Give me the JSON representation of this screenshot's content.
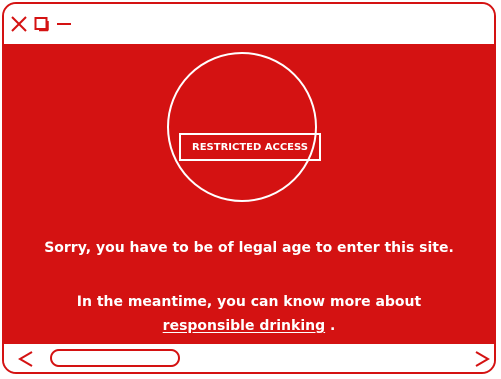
{
  "window": {
    "accent_color": "#d41212",
    "controls": [
      "close-icon",
      "maximize-icon",
      "minimize-icon"
    ]
  },
  "content": {
    "badge_text": "RESTRICTED ACCESS",
    "message_line1": "Sorry, you have to be of  legal age to enter this site.",
    "message_line2": "In the meantime, you can know more about",
    "link_text": "responsible drinking",
    "link_suffix": " ."
  },
  "footer": {
    "left_arrow_icon": "chevron-left-icon",
    "right_arrow_icon": "chevron-right-icon"
  }
}
